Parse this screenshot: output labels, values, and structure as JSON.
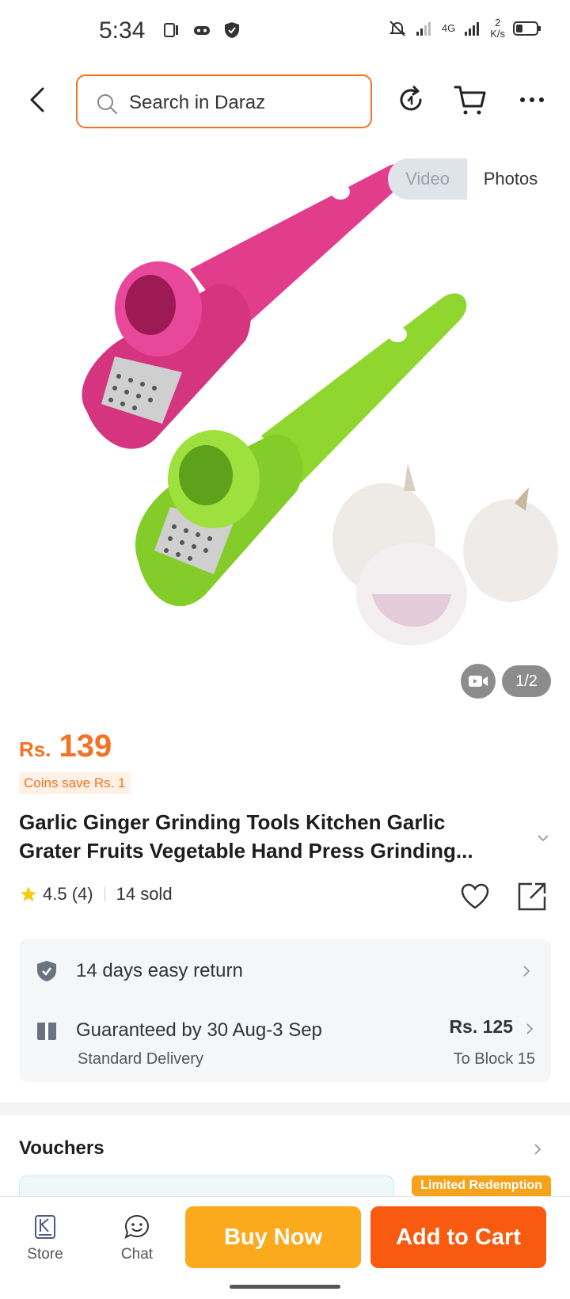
{
  "status_bar": {
    "time": "5:34",
    "network": "4G",
    "speed_value": "2",
    "speed_unit": "K/s"
  },
  "header": {
    "search_placeholder": "Search in Daraz"
  },
  "gallery": {
    "toggle_video": "Video",
    "toggle_photos": "Photos",
    "counter": "1/2",
    "colors": {
      "pink_tool": "#e23d8d",
      "green_tool": "#8fd62f"
    }
  },
  "product": {
    "price_currency": "Rs.",
    "price_value": "139",
    "coins_save": "Coins save Rs. 1",
    "title_line1": "Garlic Ginger Grinding Tools Kitchen Garlic",
    "title_line2": "Grater Fruits Vegetable Hand Press Grinding...",
    "rating": "4.5",
    "rating_count": "(4)",
    "sold": "14 sold"
  },
  "delivery": {
    "return_text": "14 days easy return",
    "guarantee_text": "Guaranteed by 30 Aug-3 Sep",
    "delivery_type": "Standard Delivery",
    "delivery_price": "Rs. 125",
    "destination": "To Block 15"
  },
  "vouchers": {
    "title": "Vouchers",
    "limited_badge": "Limited Redemption"
  },
  "bottom_bar": {
    "store_label": "Store",
    "chat_label": "Chat",
    "buy_now_label": "Buy Now",
    "add_to_cart_label": "Add to Cart"
  },
  "theme": {
    "accent": "#f57224",
    "buy_now": "#fba91d",
    "add_to_cart": "#f85a0f"
  }
}
